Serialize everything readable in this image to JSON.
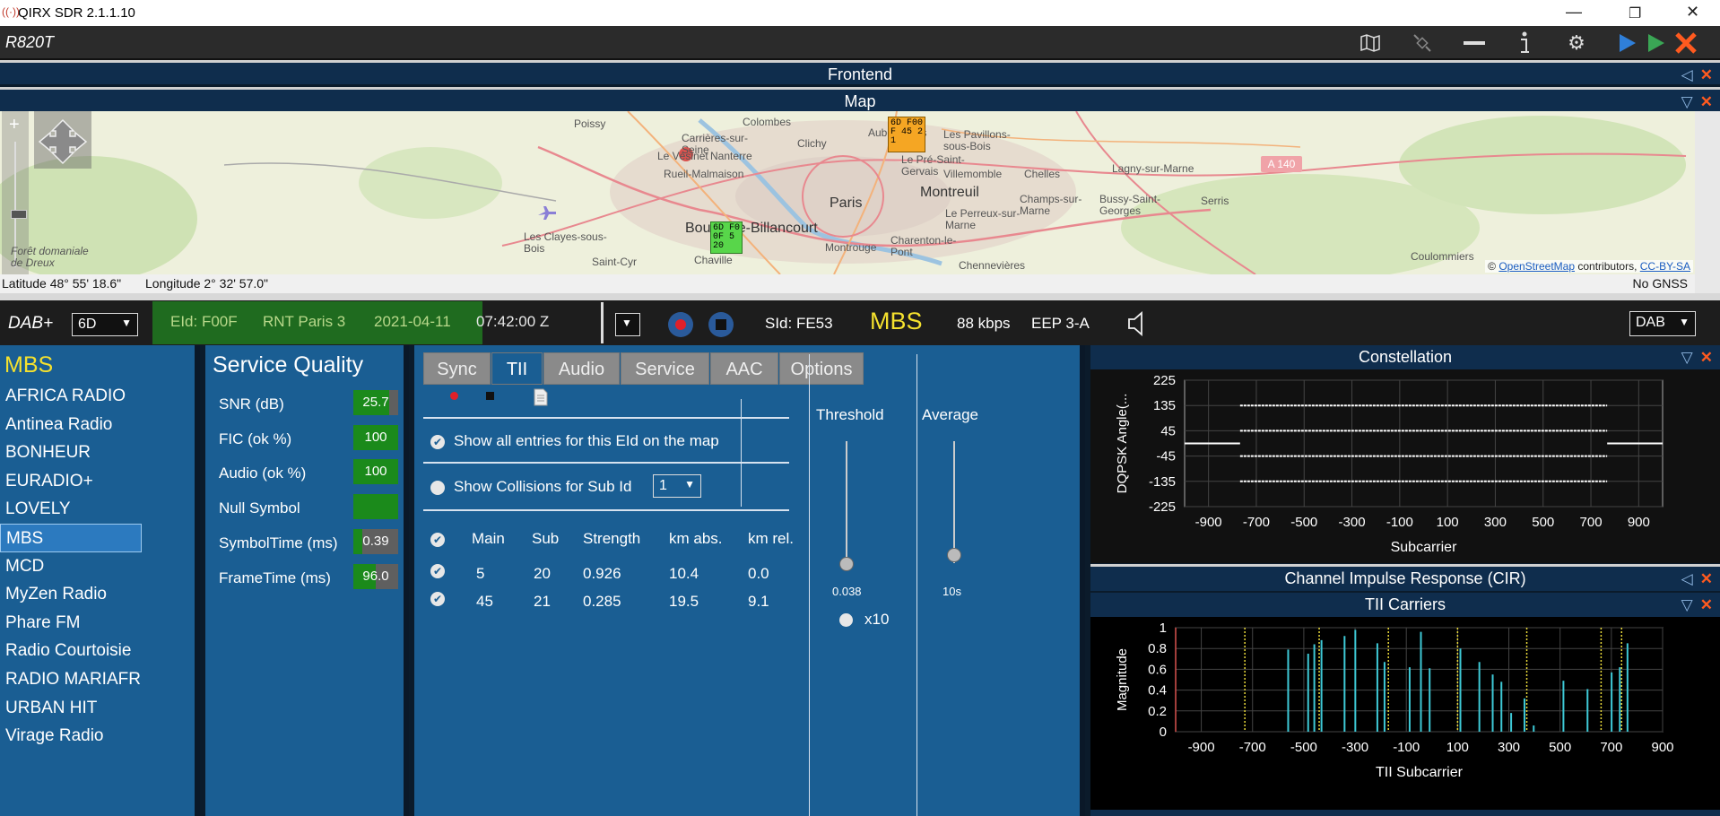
{
  "window": {
    "title": "QIRX SDR 2.1.1.10"
  },
  "toolbar": {
    "device": "R820T"
  },
  "panels": {
    "frontend": "Frontend",
    "map": "Map"
  },
  "map": {
    "places": [
      "Poissy",
      "Colombes",
      "Aubervilliers",
      "Les Pavillons-sous-Bois",
      "Carrières-sur-Seine",
      "Nanterre",
      "Le Vésinet",
      "Clichy",
      "Le Pré-Saint-Gervais",
      "Villemomble",
      "Chelles",
      "Lagny-sur-Marne",
      "Rueil-Malmaison",
      "Paris",
      "Montreuil",
      "Champs-sur-Marne",
      "Bussy-Saint-Georges",
      "Serris",
      "Boulogne-Billancourt",
      "Charenton-le-Pont",
      "Le Perreux-sur-Marne",
      "Les Clayes-sous-Bois",
      "Forêt domaniale de Dreux",
      "Saint-Cyr",
      "Chaville",
      "Montrouge",
      "Chennevières",
      "Coulommiers"
    ],
    "markers": [
      {
        "label": "6D F00F 45 21",
        "color": "#f5a623"
      },
      {
        "label": "6D F00F 5 20",
        "color": "#58d64a"
      }
    ],
    "road_label": "A 140",
    "attribution_prefix": "©",
    "attribution_link": "OpenStreetMap",
    "attribution_mid": "contributors,",
    "attribution_license": "CC-BY-SA"
  },
  "coords": {
    "latitude": "Latitude  48° 55' 18.6\"",
    "longitude": "Longitude  2° 32' 57.0\"",
    "gnss": "No GNSS"
  },
  "dab": {
    "mode": "DAB+",
    "channel": "6D",
    "eid": "EId: F00F",
    "ensemble": "RNT Paris 3",
    "date": "2021-04-11",
    "time": "07:42:00 Z",
    "sid": "SId: FE53",
    "service": "MBS",
    "bitrate": "88 kbps",
    "eep": "EEP 3-A",
    "band": "DAB"
  },
  "services": {
    "header": "MBS",
    "items": [
      "AFRICA RADIO",
      "Antinea Radio",
      "BONHEUR",
      "EURADIO+",
      "LOVELY",
      "MBS",
      "MCD",
      "MyZen Radio",
      "Phare FM",
      "Radio Courtoisie",
      "RADIO MARIAFR",
      "URBAN HIT",
      "Virage Radio"
    ],
    "selected": "MBS"
  },
  "quality": {
    "title": "Service Quality",
    "rows": [
      {
        "label": "SNR (dB)",
        "value": "25.7",
        "fill": 0.8
      },
      {
        "label": "FIC (ok %)",
        "value": "100",
        "fill": 1.0
      },
      {
        "label": "Audio (ok %)",
        "value": "100",
        "fill": 1.0
      },
      {
        "label": "Null Symbol",
        "value": "",
        "fill": 1.0
      },
      {
        "label": "SymbolTime (ms)",
        "value": "0.39",
        "fill": 0.2
      },
      {
        "label": "FrameTime (ms)",
        "value": "96.0",
        "fill": 0.5
      }
    ]
  },
  "tabs": [
    "Sync",
    "TII",
    "Audio",
    "Service",
    "AAC",
    "Options"
  ],
  "tii": {
    "show_all": "Show all entries for this EId on the map",
    "show_collisions": "Show Collisions for Sub Id",
    "collision_value": "1",
    "columns": [
      "Main",
      "Sub",
      "Strength",
      "km abs.",
      "km rel."
    ],
    "rows": [
      [
        "5",
        "20",
        "0.926",
        "10.4",
        "0.0"
      ],
      [
        "45",
        "21",
        "0.285",
        "19.5",
        "9.1"
      ]
    ],
    "threshold_label": "Threshold",
    "threshold_value": "0.038",
    "threshold_level": 0.038,
    "x10_label": "x10",
    "average_label": "Average",
    "average_value": "10s"
  },
  "right_panels": {
    "constellation": "Constellation",
    "cir": "Channel Impulse Response (CIR)",
    "tii_carriers": "TII Carriers"
  },
  "chart_data": [
    {
      "type": "scatter",
      "title": "Constellation",
      "xlabel": "Subcarrier",
      "ylabel": "DQPSK  Angle(...",
      "xlim": [
        -1000,
        1000
      ],
      "ylim": [
        -225,
        225
      ],
      "xticks": [
        -900,
        -700,
        -500,
        -300,
        -100,
        100,
        300,
        500,
        700,
        900
      ],
      "yticks": [
        225,
        135,
        45,
        -45,
        -135,
        -225
      ],
      "bands": [
        135,
        45,
        -45,
        -135
      ],
      "x_range": [
        -768,
        768
      ],
      "outside_level": 0,
      "grid": true
    },
    {
      "type": "bar",
      "title": "TII Carriers",
      "xlabel": "TII Subcarrier",
      "ylabel": "Magnitude",
      "xlim": [
        -1000,
        900
      ],
      "ylim": [
        0,
        1.0
      ],
      "xticks": [
        -900,
        -700,
        -500,
        -300,
        -100,
        100,
        300,
        500,
        700,
        900
      ],
      "yticks": [
        1.0,
        0.8,
        0.6,
        0.4,
        0.2,
        0.0
      ],
      "x": [
        -561,
        -483,
        -459,
        -431,
        -341,
        -299,
        -213,
        -185,
        -87,
        -43,
        -9,
        111,
        185,
        237,
        271,
        309,
        361,
        397,
        513,
        607,
        701,
        733,
        763
      ],
      "values": [
        0.79,
        0.75,
        0.84,
        0.88,
        0.92,
        0.98,
        0.85,
        0.67,
        0.62,
        0.96,
        0.61,
        0.8,
        0.67,
        0.55,
        0.48,
        0.18,
        0.32,
        0.06,
        0.49,
        0.41,
        0.57,
        0.62,
        0.85
      ],
      "markers": [
        -730,
        -440,
        -170,
        100,
        370,
        660,
        740
      ],
      "grid": true
    }
  ]
}
